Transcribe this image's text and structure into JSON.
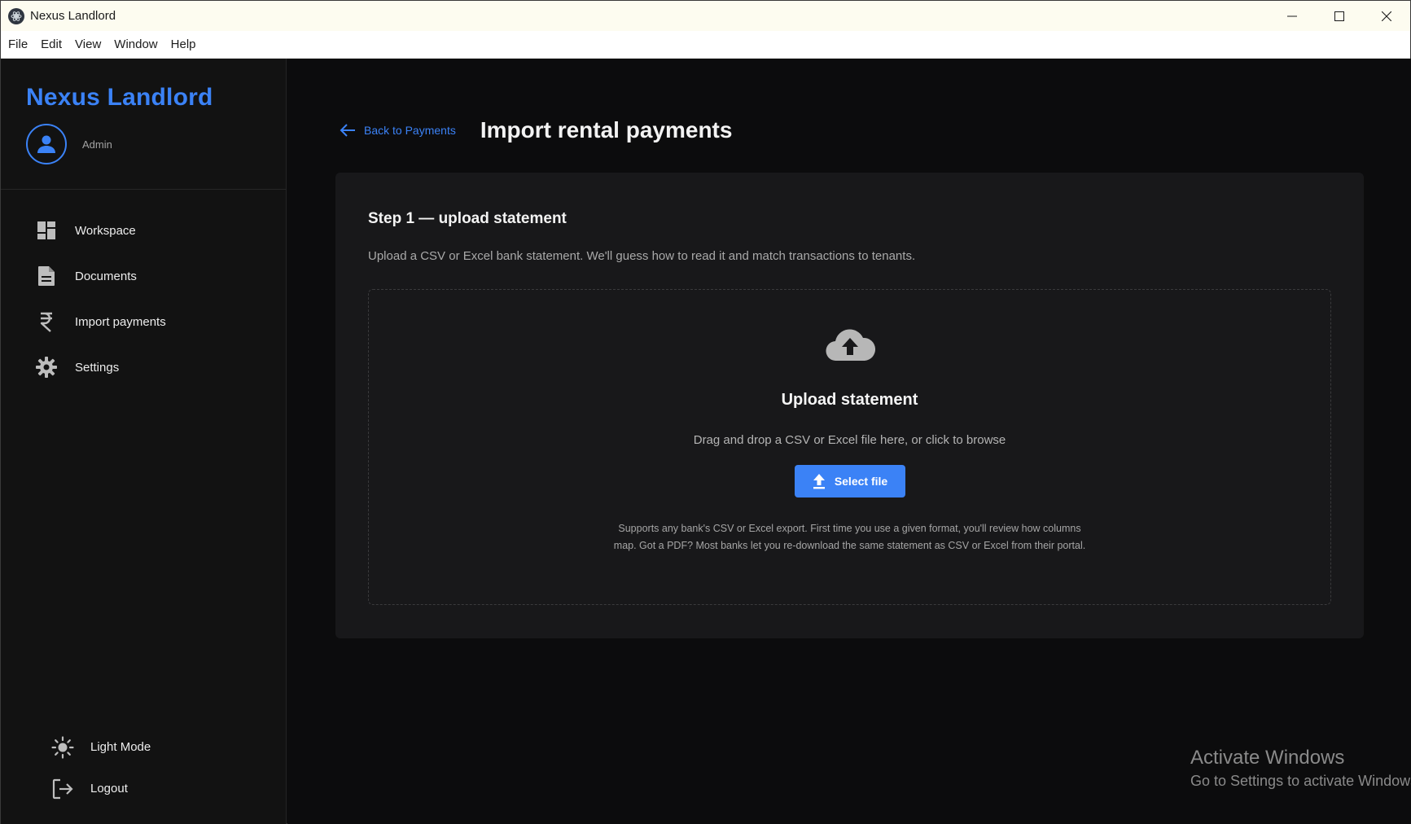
{
  "window": {
    "title": "Nexus Landlord"
  },
  "menubar": {
    "items": [
      "File",
      "Edit",
      "View",
      "Window",
      "Help"
    ]
  },
  "sidebar": {
    "brand": "Nexus Landlord",
    "user_role": "Admin",
    "nav": [
      {
        "label": "Workspace",
        "icon": "dashboard-icon"
      },
      {
        "label": "Documents",
        "icon": "document-icon"
      },
      {
        "label": "Import payments",
        "icon": "rupee-icon"
      },
      {
        "label": "Settings",
        "icon": "gear-icon"
      }
    ],
    "bottom": [
      {
        "label": "Light Mode",
        "icon": "sun-icon"
      },
      {
        "label": "Logout",
        "icon": "logout-icon"
      }
    ]
  },
  "main": {
    "back_link": "Back to Payments",
    "page_title": "Import rental payments",
    "step_title": "Step 1 — upload statement",
    "step_description": "Upload a CSV or Excel bank statement. We'll guess how to read it and match transactions to tenants.",
    "dropzone": {
      "title": "Upload statement",
      "subtitle": "Drag and drop a CSV or Excel file here, or click to browse",
      "button_label": "Select file",
      "note": "Supports any bank's CSV or Excel export. First time you use a given format, you'll review how columns map. Got a PDF? Most banks let you re-download the same statement as CSV or Excel from their portal."
    }
  },
  "watermark": {
    "line1": "Activate Windows",
    "line2": "Go to Settings to activate Windows."
  },
  "colors": {
    "accent": "#3b82f6",
    "background": "#0c0c0d",
    "sidebar": "#121212",
    "card": "#18181a"
  }
}
